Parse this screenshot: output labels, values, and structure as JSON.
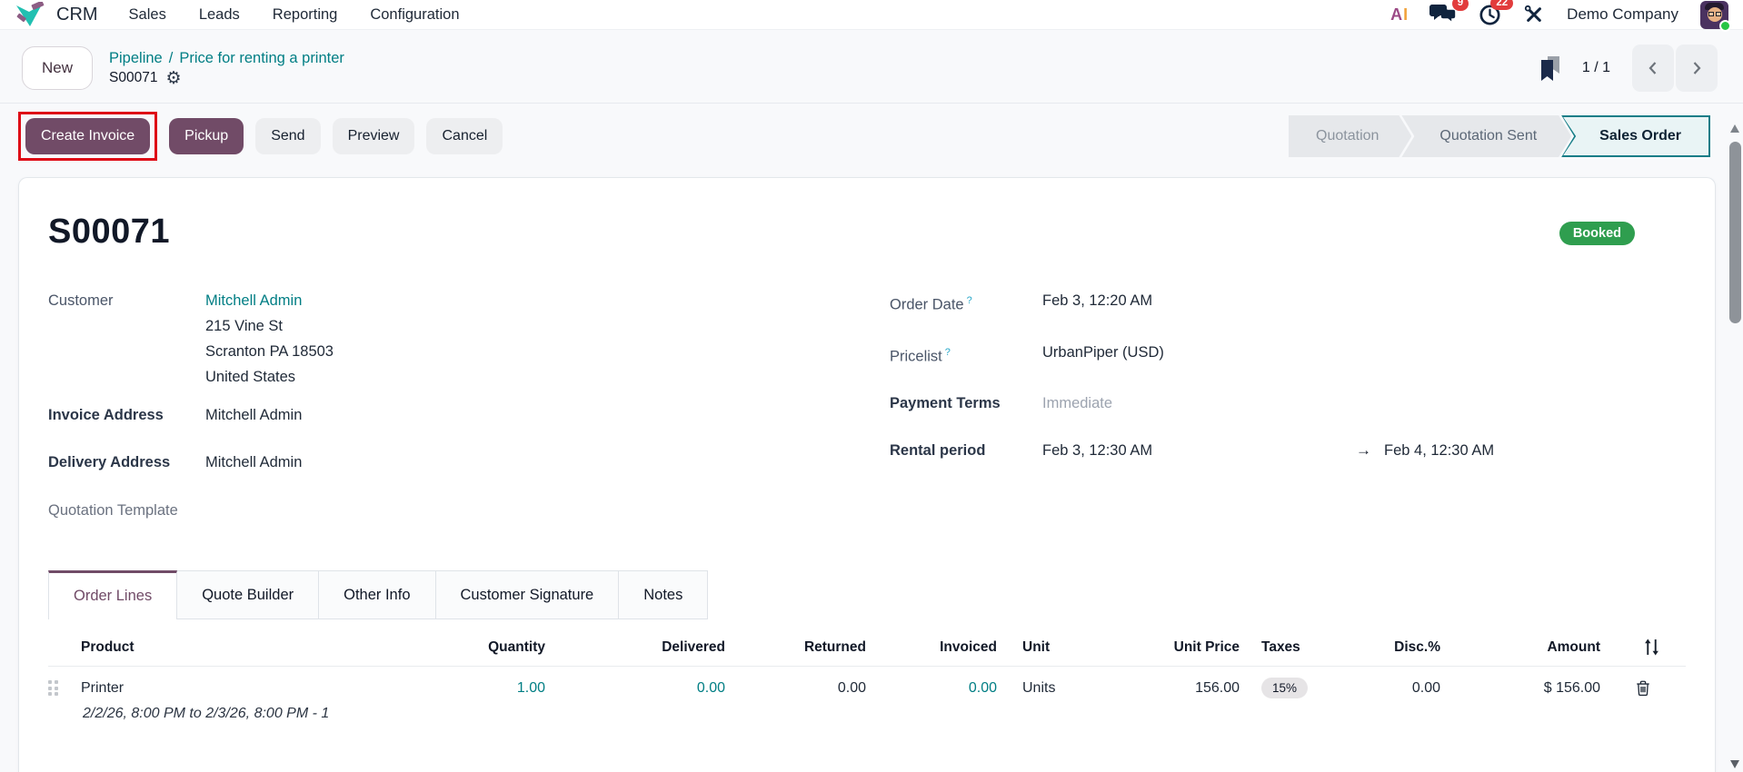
{
  "colors": {
    "accent_purple": "#714B67",
    "link_teal": "#017E84",
    "stage_active_border": "#157D87",
    "booked_green": "#2F9E4F",
    "notification_red": "#E23C3C",
    "annotation_red": "#DE0A16"
  },
  "topnav": {
    "app_name": "CRM",
    "menus": [
      {
        "label": "Sales"
      },
      {
        "label": "Leads"
      },
      {
        "label": "Reporting"
      },
      {
        "label": "Configuration"
      }
    ],
    "ai": {
      "a": "A",
      "i": "I"
    },
    "messages_badge": "9",
    "activities_badge": "22",
    "company": "Demo Company"
  },
  "breadcrumb": {
    "new_label": "New",
    "link1": "Pipeline",
    "separator": "/",
    "link2": "Price for renting a printer",
    "current": "S00071",
    "gear_glyph": "⚙",
    "pager": "1 / 1"
  },
  "actions": {
    "create_invoice": "Create Invoice",
    "pickup": "Pickup",
    "send": "Send",
    "preview": "Preview",
    "cancel": "Cancel"
  },
  "statusbar": [
    {
      "label": "Quotation"
    },
    {
      "label": "Quotation Sent"
    },
    {
      "label": "Sales Order",
      "active": true
    }
  ],
  "form": {
    "title": "S00071",
    "status_badge": "Booked",
    "customer_label": "Customer",
    "customer_value": "Mitchell Admin",
    "customer_address": [
      "215 Vine St",
      "Scranton PA 18503",
      "United States"
    ],
    "invoice_address_label": "Invoice Address",
    "invoice_address_value": "Mitchell Admin",
    "delivery_address_label": "Delivery Address",
    "delivery_address_value": "Mitchell Admin",
    "quotation_template_label": "Quotation Template",
    "order_date_label": "Order Date",
    "order_date_help": "?",
    "order_date_value": "Feb 3, 12:20 AM",
    "pricelist_label": "Pricelist",
    "pricelist_help": "?",
    "pricelist_value": "UrbanPiper (USD)",
    "payment_terms_label": "Payment Terms",
    "payment_terms_placeholder": "Immediate",
    "rental_period_label": "Rental period",
    "rental_start": "Feb 3, 12:30 AM",
    "rental_arrow": "→",
    "rental_end": "Feb 4, 12:30 AM"
  },
  "tabs": [
    {
      "label": "Order Lines",
      "active": true
    },
    {
      "label": "Quote Builder"
    },
    {
      "label": "Other Info"
    },
    {
      "label": "Customer Signature"
    },
    {
      "label": "Notes"
    }
  ],
  "order_lines": {
    "columns": [
      "Product",
      "Quantity",
      "Delivered",
      "Returned",
      "Invoiced",
      "Unit",
      "Unit Price",
      "Taxes",
      "Disc.%",
      "Amount"
    ],
    "rows": [
      {
        "product": "Printer",
        "quantity": "1.00",
        "delivered": "0.00",
        "returned": "0.00",
        "invoiced": "0.00",
        "unit": "Units",
        "unit_price": "156.00",
        "taxes": "15%",
        "disc": "0.00",
        "amount": "$ 156.00",
        "note": "2/2/26, 8:00 PM to 2/3/26, 8:00 PM - 1"
      }
    ]
  }
}
